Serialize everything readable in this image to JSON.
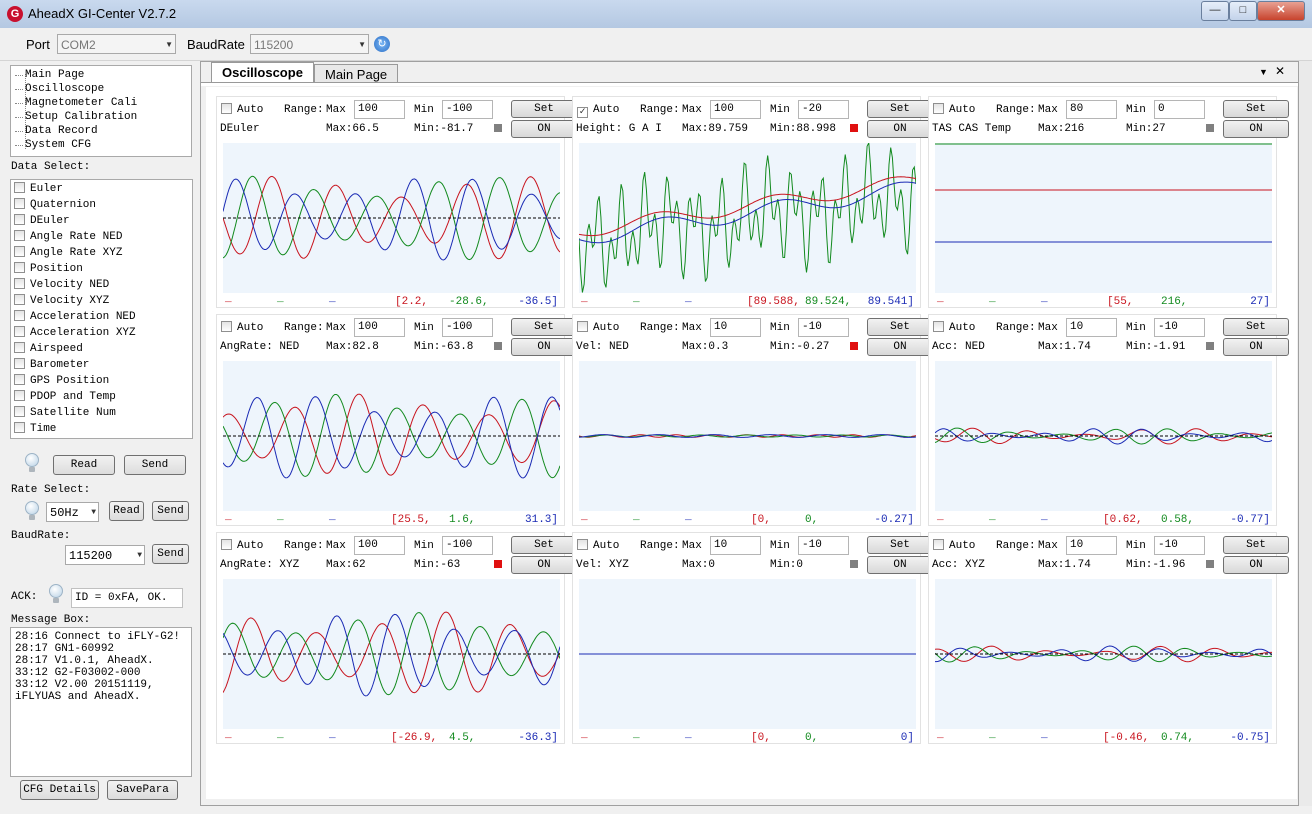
{
  "window": {
    "title": "AheadX GI-Center V2.7.2",
    "logo": "G",
    "minimize": "—",
    "maximize": "□",
    "close": "✕"
  },
  "toolbar": {
    "port_label": "Port",
    "port_value": "COM2",
    "baud_label": "BaudRate",
    "baud_value": "115200",
    "refresh_icon": "refresh-icon"
  },
  "nav_tree": [
    "Main Page",
    "Oscilloscope",
    "Magnetometer Cali",
    "Setup Calibration",
    "Data Record",
    "System CFG"
  ],
  "data_select": {
    "label": "Data Select:",
    "items": [
      "Euler",
      "Quaternion",
      "DEuler",
      "Angle Rate NED",
      "Angle Rate XYZ",
      "Position",
      "Velocity NED",
      "Velocity XYZ",
      "Acceleration NED",
      "Acceleration XYZ",
      "Airspeed",
      "Barometer",
      "GPS Position",
      "PDOP and Temp",
      "Satellite Num",
      "Time"
    ],
    "read_label": "Read",
    "send_label": "Send"
  },
  "rate": {
    "label": "Rate Select:",
    "value": "50Hz",
    "read_label": "Read",
    "send_label": "Send"
  },
  "baud": {
    "label": "BaudRate:",
    "value": "115200",
    "send_label": "Send"
  },
  "ack": {
    "label": "ACK:",
    "value": "ID = 0xFA, OK."
  },
  "message_box": {
    "label": "Message Box:",
    "lines": [
      "28:16 Connect to iFLY-G2!",
      "28:17 GN1-60992",
      "28:17 V1.0.1, AheadX.",
      "33:12 G2-F03002-000",
      "33:12 V2.00 20151119, iFLYUAS and AheadX."
    ]
  },
  "bottom_buttons": {
    "cfg": "CFG Details",
    "save": "SavePara"
  },
  "tabs": {
    "active": "Oscilloscope",
    "other": "Main Page",
    "dropdown": "▼",
    "close": "✕"
  },
  "scope_labels": {
    "auto": "Auto",
    "range": "Range:",
    "max": "Max",
    "min": "Min",
    "set": "Set",
    "on": "ON",
    "dash": "_"
  },
  "colors": {
    "red": "#c8141e",
    "green": "#128a1e",
    "blue": "#1a2ab4",
    "plot_bg": "#eef5fc",
    "led_gray": "#808080",
    "led_red": "#e01010"
  },
  "scopes": [
    {
      "title": "DEuler",
      "auto": false,
      "max_input": "100",
      "min_input": "-100",
      "max_stat": "Max:66.5",
      "min_stat": "Min:-81.7",
      "led": "gray",
      "values": [
        "[2.2,",
        "-28.6,",
        "-36.5]"
      ],
      "chart_kind": "osc_large"
    },
    {
      "title": "Height: G A I",
      "auto": true,
      "max_input": "100",
      "min_input": "-20",
      "max_stat": "Max:89.759",
      "min_stat": "Min:88.998",
      "led": "red",
      "values": [
        "[89.588,",
        "89.524,",
        "89.541]"
      ],
      "chart_kind": "height"
    },
    {
      "title": "TAS CAS Temp",
      "auto": false,
      "max_input": "80",
      "min_input": "0",
      "max_stat": "Max:216",
      "min_stat": "Min:27",
      "led": "gray",
      "values": [
        "[55,",
        "216,",
        "27]"
      ],
      "chart_kind": "flat3"
    },
    {
      "title": "AngRate: NED",
      "auto": false,
      "max_input": "100",
      "min_input": "-100",
      "max_stat": "Max:82.8",
      "min_stat": "Min:-63.8",
      "led": "gray",
      "values": [
        "[25.5,",
        "1.6,",
        "31.3]"
      ],
      "chart_kind": "osc_large"
    },
    {
      "title": "Vel: NED",
      "auto": false,
      "max_input": "10",
      "min_input": "-10",
      "max_stat": "Max:0.3",
      "min_stat": "Min:-0.27",
      "led": "red",
      "values": [
        "[0,",
        "0,",
        "-0.27]"
      ],
      "chart_kind": "near_flat"
    },
    {
      "title": "Acc: NED",
      "auto": false,
      "max_input": "10",
      "min_input": "-10",
      "max_stat": "Max:1.74",
      "min_stat": "Min:-1.91",
      "led": "gray",
      "values": [
        "[0.62,",
        "0.58,",
        "-0.77]"
      ],
      "chart_kind": "osc_small"
    },
    {
      "title": "AngRate: XYZ",
      "auto": false,
      "max_input": "100",
      "min_input": "-100",
      "max_stat": "Max:62",
      "min_stat": "Min:-63",
      "led": "red",
      "values": [
        "[-26.9,",
        "4.5,",
        "-36.3]"
      ],
      "chart_kind": "osc_large"
    },
    {
      "title": "Vel: XYZ",
      "auto": false,
      "max_input": "10",
      "min_input": "-10",
      "max_stat": "Max:0",
      "min_stat": "Min:0",
      "led": "gray",
      "values": [
        "[0,",
        "0,",
        "0]"
      ],
      "chart_kind": "flat_one"
    },
    {
      "title": "Acc: XYZ",
      "auto": false,
      "max_input": "10",
      "min_input": "-10",
      "max_stat": "Max:1.74",
      "min_stat": "Min:-1.96",
      "led": "gray",
      "values": [
        "[-0.46,",
        "0.74,",
        "-0.75]"
      ],
      "chart_kind": "osc_small"
    }
  ]
}
